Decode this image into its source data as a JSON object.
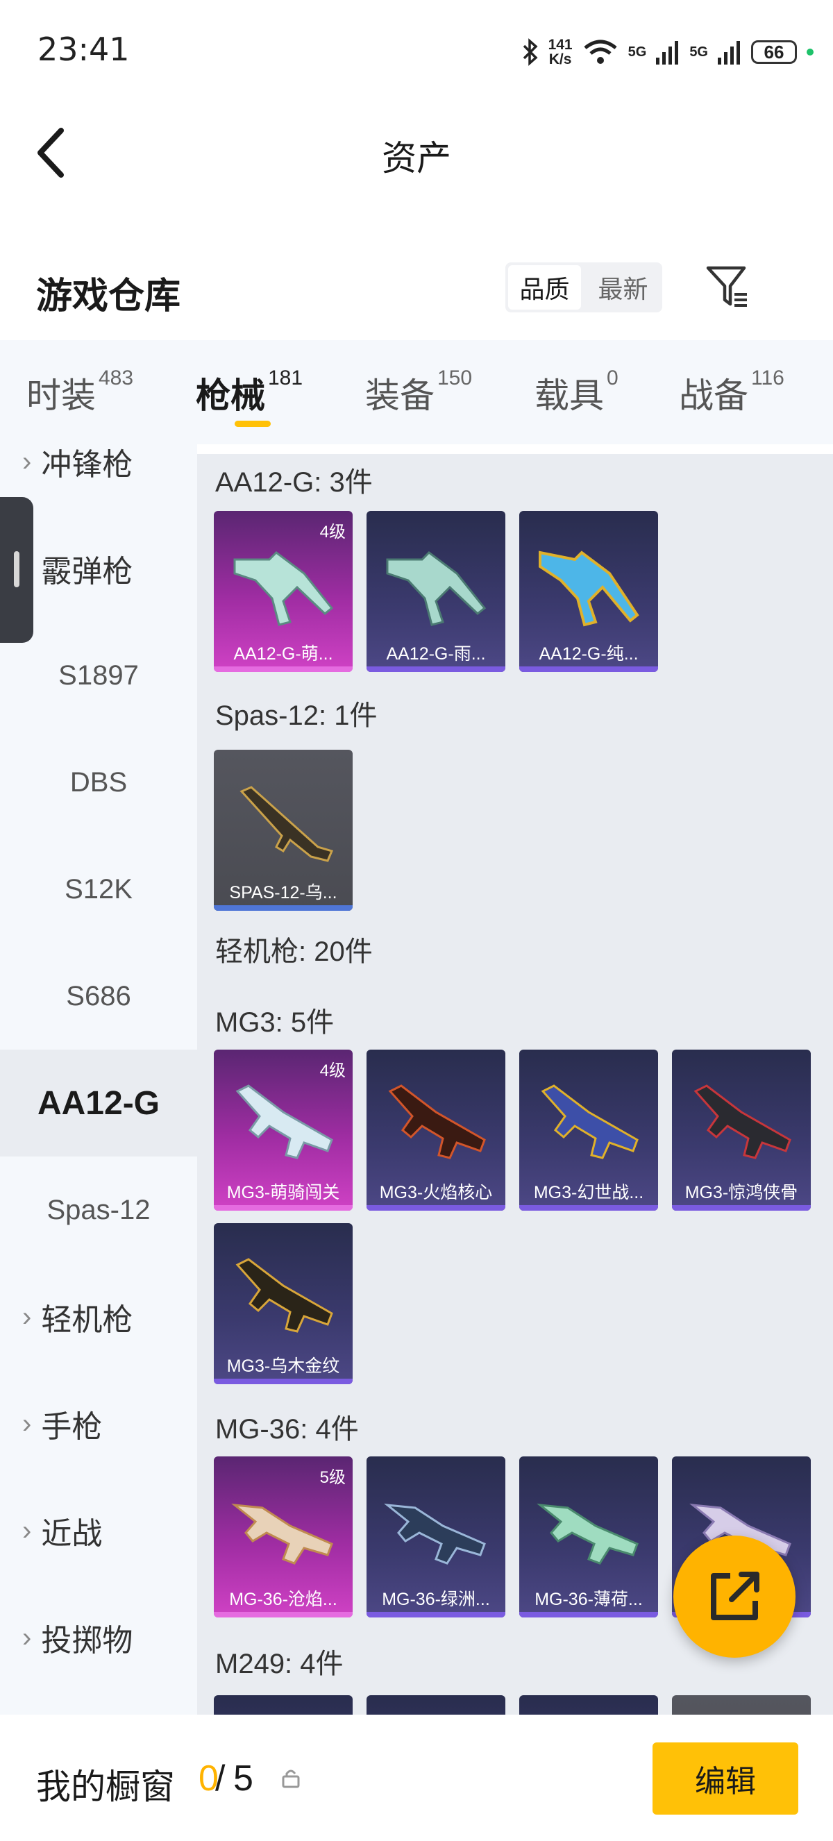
{
  "status_bar": {
    "time": "23:41",
    "net_speed_value": "141",
    "net_speed_unit": "K/s",
    "signal_1": "5G",
    "signal_2": "5G",
    "battery": "66"
  },
  "header": {
    "title": "资产"
  },
  "warehouse": {
    "title": "游戏仓库",
    "sort_options": [
      "品质",
      "最新"
    ],
    "active_sort": "品质"
  },
  "tabs": [
    {
      "label": "时装",
      "count": "483"
    },
    {
      "label": "枪械",
      "count": "181",
      "active": true
    },
    {
      "label": "装备",
      "count": "150"
    },
    {
      "label": "载具",
      "count": "0"
    },
    {
      "label": "战备",
      "count": "116"
    }
  ],
  "sidebar": {
    "items": [
      {
        "label": "冲锋枪",
        "type": "category"
      },
      {
        "label": "霰弹枪",
        "type": "category-open"
      },
      {
        "label": "S1897",
        "type": "sub"
      },
      {
        "label": "DBS",
        "type": "sub"
      },
      {
        "label": "S12K",
        "type": "sub"
      },
      {
        "label": "S686",
        "type": "sub"
      },
      {
        "label": "AA12-G",
        "type": "sub",
        "active": true
      },
      {
        "label": "Spas-12",
        "type": "sub"
      },
      {
        "label": "轻机枪",
        "type": "category"
      },
      {
        "label": "手枪",
        "type": "category"
      },
      {
        "label": "近战",
        "type": "category"
      },
      {
        "label": "投掷物",
        "type": "category"
      }
    ]
  },
  "content": {
    "groups": [
      {
        "title": "AA12-G: 3件",
        "items": [
          {
            "name": "AA12-G-萌...",
            "level": "4级",
            "rarity": "pink"
          },
          {
            "name": "AA12-G-雨...",
            "rarity": "purple"
          },
          {
            "name": "AA12-G-纯...",
            "rarity": "purple"
          }
        ]
      },
      {
        "title": "Spas-12: 1件",
        "items": [
          {
            "name": "SPAS-12-乌...",
            "rarity": "grey"
          }
        ]
      },
      {
        "title": "轻机枪: 20件",
        "items": []
      },
      {
        "title": "MG3: 5件",
        "items": [
          {
            "name": "MG3-萌骑闯关",
            "level": "4级",
            "rarity": "pink"
          },
          {
            "name": "MG3-火焰核心",
            "rarity": "purple"
          },
          {
            "name": "MG3-幻世战...",
            "rarity": "purple"
          },
          {
            "name": "MG3-惊鸿侠骨",
            "rarity": "purple"
          },
          {
            "name": "MG3-乌木金纹",
            "rarity": "purple"
          }
        ]
      },
      {
        "title": "MG-36: 4件",
        "items": [
          {
            "name": "MG-36-沧焰...",
            "level": "5级",
            "rarity": "pink"
          },
          {
            "name": "MG-36-绿洲...",
            "rarity": "purple"
          },
          {
            "name": "MG-36-薄荷...",
            "rarity": "purple"
          },
          {
            "name": "...",
            "rarity": "purple"
          }
        ]
      },
      {
        "title": "M249: 4件",
        "items": []
      }
    ]
  },
  "bottom_bar": {
    "label": "我的橱窗",
    "used": "0",
    "slash": "/",
    "total": "5",
    "edit_label": "编辑"
  },
  "colors": {
    "accent": "#ffc107",
    "legendary_pink": "#d042c5",
    "epic_purple": "#7a5be0",
    "rare_blue": "#4f76d6"
  },
  "icons": [
    "bluetooth-icon",
    "wifi-icon",
    "signal-icon",
    "battery-icon",
    "back-arrow-icon",
    "filter-icon",
    "chevron-right-icon",
    "share-icon",
    "lock-icon"
  ]
}
